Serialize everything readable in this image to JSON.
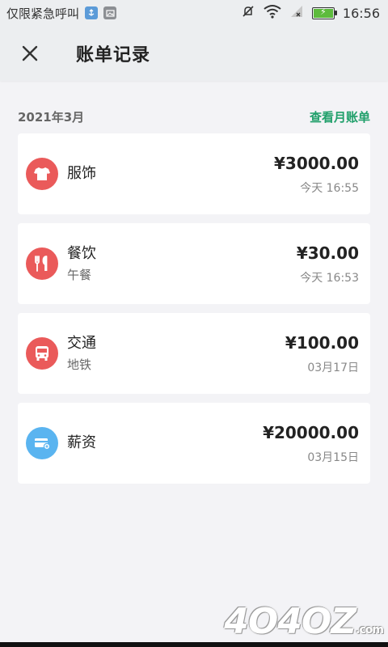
{
  "status_bar": {
    "carrier": "仅限紧急呼叫",
    "time": "16:56",
    "icons": [
      "usb-notification-icon",
      "image-notification-icon",
      "mute-icon",
      "wifi-icon",
      "signal-icon",
      "battery-charging-icon"
    ]
  },
  "app_bar": {
    "close_icon": "close-icon",
    "title": "账单记录"
  },
  "month": {
    "label": "2021年3月",
    "link": "查看月账单"
  },
  "records": [
    {
      "icon": "shirt-icon",
      "color": "#ea5a5a",
      "category": "服饰",
      "note": "",
      "amount": "¥3000.00",
      "date": "今天 16:55"
    },
    {
      "icon": "fork-knife-icon",
      "color": "#ea5a5a",
      "category": "餐饮",
      "note": "午餐",
      "amount": "¥30.00",
      "date": "今天 16:53"
    },
    {
      "icon": "bus-icon",
      "color": "#ea5a5a",
      "category": "交通",
      "note": "地铁",
      "amount": "¥100.00",
      "date": "03月17日"
    },
    {
      "icon": "salary-card-icon",
      "color": "#5ab4f0",
      "category": "薪资",
      "note": "",
      "amount": "¥20000.00",
      "date": "03月15日"
    }
  ],
  "watermark": {
    "text": "4O4OZ",
    "suffix": ".com"
  }
}
